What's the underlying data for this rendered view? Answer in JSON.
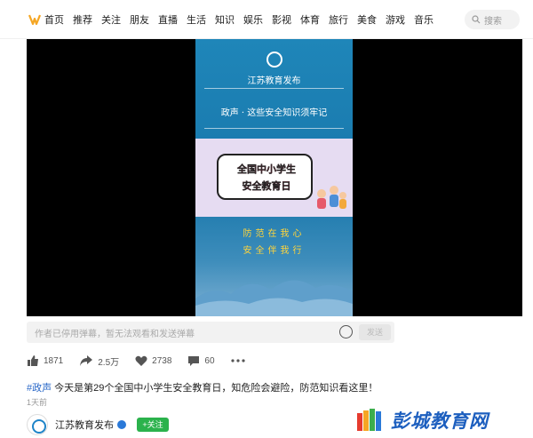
{
  "nav": {
    "items": [
      "首页",
      "推荐",
      "关注",
      "朋友",
      "直播",
      "生活",
      "知识",
      "娱乐",
      "影视",
      "体育",
      "旅行",
      "美食",
      "游戏",
      "音乐"
    ],
    "search_placeholder": "搜索"
  },
  "poster": {
    "org": "江苏教育发布",
    "headline": "政声 · 这些安全知识须牢记",
    "banner_line1": "全国中小学生",
    "banner_line2": "安全教育日",
    "slogan1": "防范在我心",
    "slogan2": "安全伴我行"
  },
  "danmu": {
    "placeholder": "作者已停用弹幕，暂无法观看和发送弹幕",
    "send_label": "发送"
  },
  "actions": {
    "likes": "1871",
    "shares": "2.5万",
    "favorites": "2738",
    "comments": "60"
  },
  "post": {
    "tag": "#政声",
    "text": " 今天是第29个全国中小学生安全教育日，知危险会避险，防范知识看这里！",
    "time": "1天前"
  },
  "author": {
    "name": "江苏教育发布",
    "follow_label": "+关注"
  },
  "watermark": {
    "text": "彭城教育网"
  },
  "colors": {
    "follow": "#2bb24c",
    "tag": "#2a68c8",
    "poster_blue": "#1877ab",
    "slogan": "#ffd43b"
  }
}
